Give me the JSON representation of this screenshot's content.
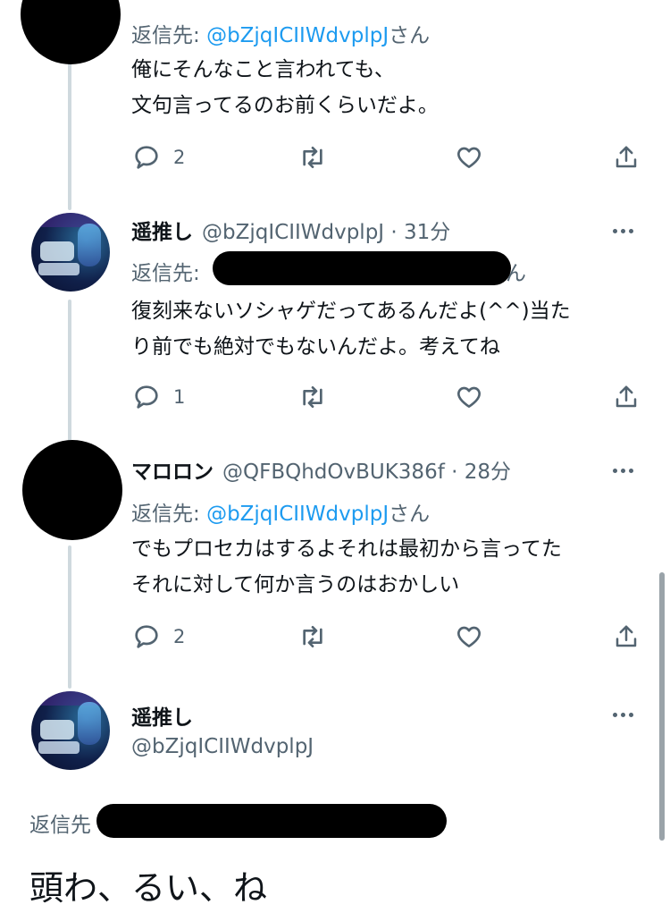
{
  "tweets": [
    {
      "reply_label": "返信先:",
      "reply_mention": "@bZjqICIIWdvplpJ",
      "reply_suffix": "さん",
      "text_lines": [
        "俺にそんなこと言われても、",
        "文句言ってるのお前くらいだよ。"
      ],
      "reply_count": "2"
    },
    {
      "name": "遥推し",
      "handle_time": "@bZjqICIIWdvplpJ · 31分",
      "reply_label": "返信先:",
      "reply_suffix_fragment": "ん",
      "text_lines": [
        "復刻来ないソシャゲだってあるんだよ(^^)当た",
        "り前でも絶対でもないんだよ。考えてね"
      ],
      "reply_count": "1"
    },
    {
      "name": "マロロン",
      "handle_time": "@QFBQhdOvBUK386f · 28分",
      "reply_label": "返信先:",
      "reply_mention": "@bZjqICIIWdvplpJ",
      "reply_suffix": "さん",
      "text_lines": [
        "でもプロセカはするよそれは最初から言ってた",
        "それに対して何か言うのはおかしい"
      ],
      "reply_count": "2"
    }
  ],
  "main_tweet": {
    "name": "遥推し",
    "handle": "@bZjqICIIWdvplpJ",
    "reply_label": "返信先",
    "text": "頭わ、るい、ね"
  },
  "icons": {
    "reply": "reply-bubble-icon",
    "retweet": "retweet-icon",
    "like": "heart-icon",
    "share": "share-icon",
    "more": "more-dots-icon"
  },
  "colors": {
    "mention": "#1d9bf0",
    "secondary_text": "#536471",
    "thread_line": "#cfd9de"
  }
}
